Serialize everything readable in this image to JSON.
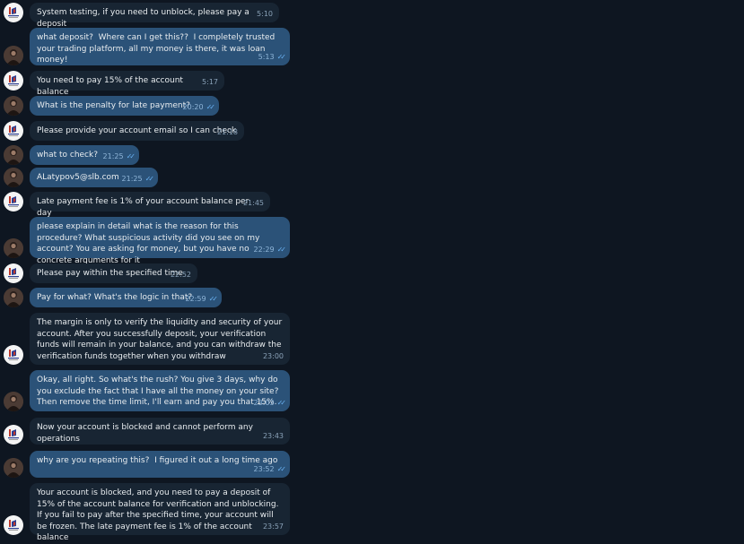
{
  "messages": [
    {
      "side": "in",
      "text": "System testing, if you need to unblock, please pay a deposit",
      "time": "5:10",
      "read": false
    },
    {
      "side": "out",
      "text": "what deposit?  Where can I get this??  I completely trusted your trading platform, all my money is there, it was loan money!",
      "time": "5:13",
      "read": true
    },
    {
      "side": "in",
      "text": "You need to pay 15% of the account balance",
      "time": "5:17",
      "read": false
    },
    {
      "side": "out",
      "text": "What is the penalty for late payment?",
      "time": "20:20",
      "read": true
    },
    {
      "side": "in",
      "text": "Please provide your account email so I can check",
      "time": "21:18",
      "read": false
    },
    {
      "side": "out",
      "text": "what to check?",
      "time": "21:25",
      "read": true
    },
    {
      "side": "out",
      "text": "ALatypov5@slb.com",
      "time": "21:25",
      "read": true
    },
    {
      "side": "in",
      "text": "Late payment fee is 1% of your account balance per day",
      "time": "21:45",
      "read": false
    },
    {
      "side": "out",
      "text": "please explain in detail what is the reason for this procedure? What suspicious activity did you see on my account? You are asking for money, but you have no concrete arguments for it",
      "time": "22:29",
      "read": true
    },
    {
      "side": "in",
      "text": "Please pay within the specified time",
      "time": "22:52",
      "read": false
    },
    {
      "side": "out",
      "text": "Pay for what? What's the logic in that?",
      "time": "22:59",
      "read": true
    },
    {
      "side": "in",
      "text": "The margin is only to verify the liquidity and security of your account. After you successfully deposit, your verification funds will remain in your balance, and you can withdraw the verification funds together when you withdraw",
      "time": "23:00",
      "read": false
    },
    {
      "side": "out",
      "text": "Okay, all right. So what's the rush? You give 3 days, why do you exclude the fact that I have all the money on your site? Then remove the time limit, I'll earn and pay you that 15%.",
      "time": "23:03",
      "read": true
    },
    {
      "side": "in",
      "text": "Now your account is blocked and cannot perform any operations",
      "time": "23:43",
      "read": false
    },
    {
      "side": "out",
      "text": "why are you repeating this?  I figured it out a long time ago",
      "time": "23:52",
      "read": true
    },
    {
      "side": "in",
      "text": "Your account is blocked, and you need to pay a deposit of 15% of the account balance for verification and unblocking. If you fail to pay after the specified time, your account will be frozen. The late payment fee is 1% of the account balance",
      "time": "23:57",
      "read": false
    }
  ],
  "colors": {
    "background": "#0e1621",
    "incoming": "#182533",
    "outgoing": "#2b5278",
    "ticks": "#6ab2f2"
  }
}
